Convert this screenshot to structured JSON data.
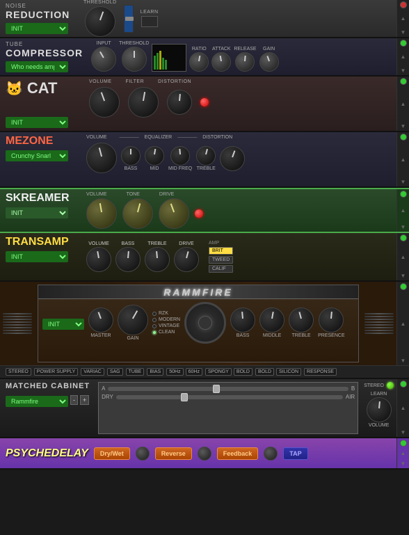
{
  "plugins": {
    "noise_reduction": {
      "label_small": "NOISE",
      "title": "REDUCTION",
      "preset": "INIT",
      "sections": {
        "threshold_label": "THRESHOLD",
        "learn_label": "LEARN"
      }
    },
    "tube_compressor": {
      "label_small": "TUBE",
      "title": "COMPRESSOR",
      "preset": "Who needs amps?",
      "knob_labels": [
        "INPUT",
        "THRESHOLD",
        "RATIO",
        "ATTACK",
        "RELEASE",
        "GAIN"
      ]
    },
    "cat": {
      "label_small": "",
      "title": "CAT",
      "preset": "INIT",
      "knob_labels": [
        "VOLUME",
        "FILTER",
        "DISTORTION"
      ]
    },
    "mezone": {
      "title": "MEZONE",
      "preset": "Crunchy Snarl",
      "knob_labels": [
        "VOLUME",
        "BASS",
        "MID",
        "MID FREQ",
        "TREBLE",
        "DISTORTION"
      ],
      "eq_label": "EQUALIZER"
    },
    "skreamer": {
      "title": "SKREAMER",
      "preset": "INIT",
      "knob_labels": [
        "VOLUME",
        "TONE",
        "DRIVE"
      ]
    },
    "transamp": {
      "title": "TRANSAMP",
      "preset": "INIT",
      "knob_labels": [
        "VOLUME",
        "BASS",
        "TREBLE",
        "DRIVE"
      ],
      "amp_label": "AMP",
      "amp_buttons": [
        "BRIT",
        "TWEED",
        "CALIF"
      ]
    },
    "rammfire": {
      "logo": "RAMMFIRE",
      "preset": "INIT",
      "radio_options": [
        "RZK",
        "MODERN",
        "VINTAGE",
        "CLEAN"
      ],
      "radio_active": "CLEAN",
      "knob_labels": [
        "MASTER",
        "GAIN",
        "BASS",
        "MIDDLE",
        "TREBLE",
        "PRESENCE"
      ],
      "bottom_controls": [
        "STEREO",
        "POWER SUPPLY",
        "VARIAC",
        "SAG",
        "TUBE",
        "BIAS",
        "50Hz",
        "60Hz",
        "SPONGY",
        "BOLD",
        "BOLD",
        "SILICON",
        "RESPONSE"
      ]
    },
    "matched_cabinet": {
      "title": "MATCHED CABINET",
      "preset": "Rammfire",
      "slider_labels": [
        "A",
        "B"
      ],
      "dry_label": "DRY",
      "air_label": "AIR",
      "stereo_label": "STEREO",
      "learn_label": "LEARN",
      "volume_label": "VOLUME"
    },
    "psychedelay": {
      "title": "PSYCHEDELAY",
      "buttons": [
        "Dry/Wet",
        "Reverse",
        "Feedback"
      ],
      "tap_label": "TAP"
    }
  },
  "icons": {
    "power": "⏻",
    "arrow_up": "▲",
    "arrow_down": "▼",
    "cat_icon": "🐱",
    "plus": "+",
    "minus": "-"
  }
}
